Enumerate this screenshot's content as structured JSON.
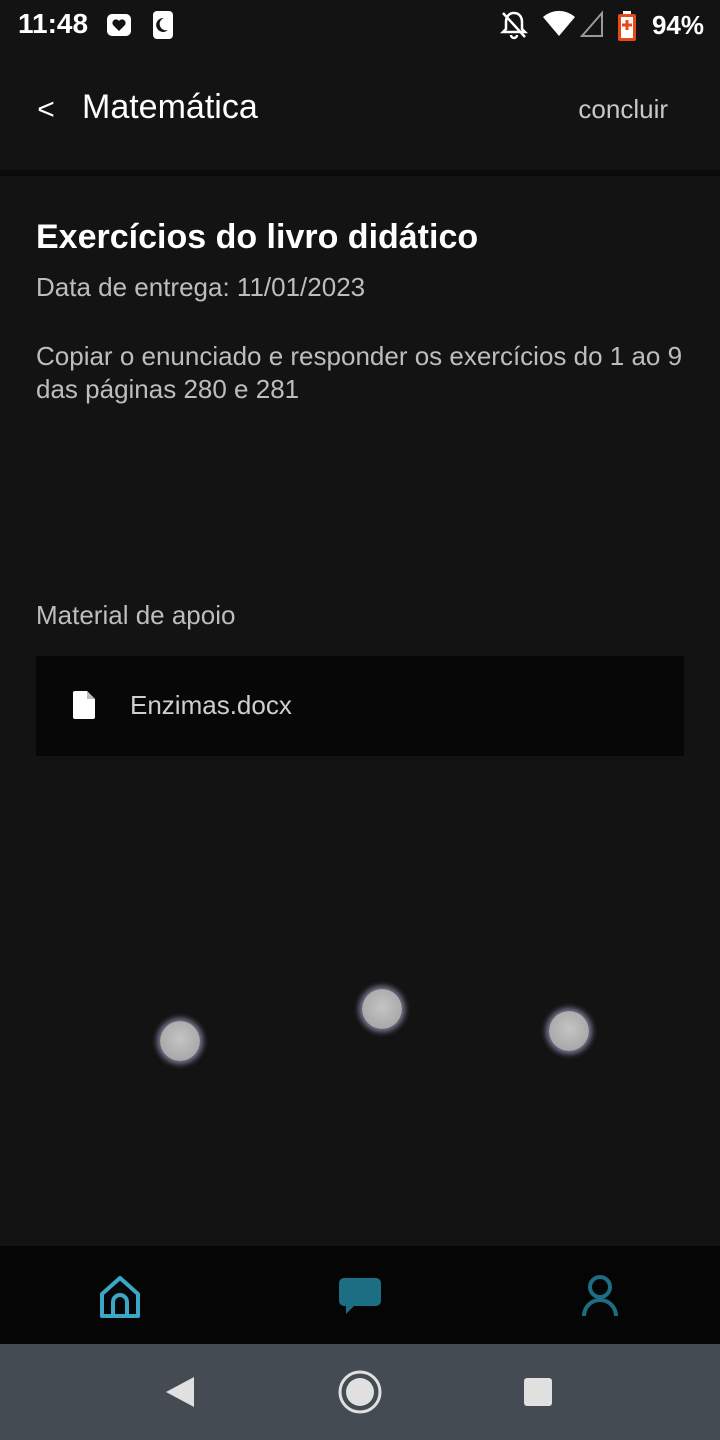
{
  "status_bar": {
    "time": "11:48",
    "battery": "94%",
    "icons": [
      "heart-badge-icon",
      "moon-badge-icon",
      "bell-off-icon",
      "wifi-icon",
      "signal-icon",
      "battery-icon"
    ]
  },
  "app_bar": {
    "back_label": "<",
    "title": "Matemática",
    "done_label": "concluir"
  },
  "task": {
    "title": "Exercícios do livro didático",
    "due": "Data de entrega: 11/01/2023",
    "description": "Copiar o enunciado e responder os exercícios do 1 ao 9 das páginas 280 e 281"
  },
  "support": {
    "label": "Material de apoio",
    "attachments": [
      {
        "name": "Enzimas.docx",
        "icon": "document-icon"
      }
    ]
  },
  "bottom_nav": {
    "items": [
      {
        "icon": "home-icon",
        "active": true
      },
      {
        "icon": "chat-icon",
        "active": false
      },
      {
        "icon": "profile-icon",
        "active": false
      }
    ]
  },
  "colors": {
    "background": "#131313",
    "accent_active": "#3aa7c7",
    "accent_inactive": "#1d6e82",
    "system_nav": "#454b52"
  }
}
